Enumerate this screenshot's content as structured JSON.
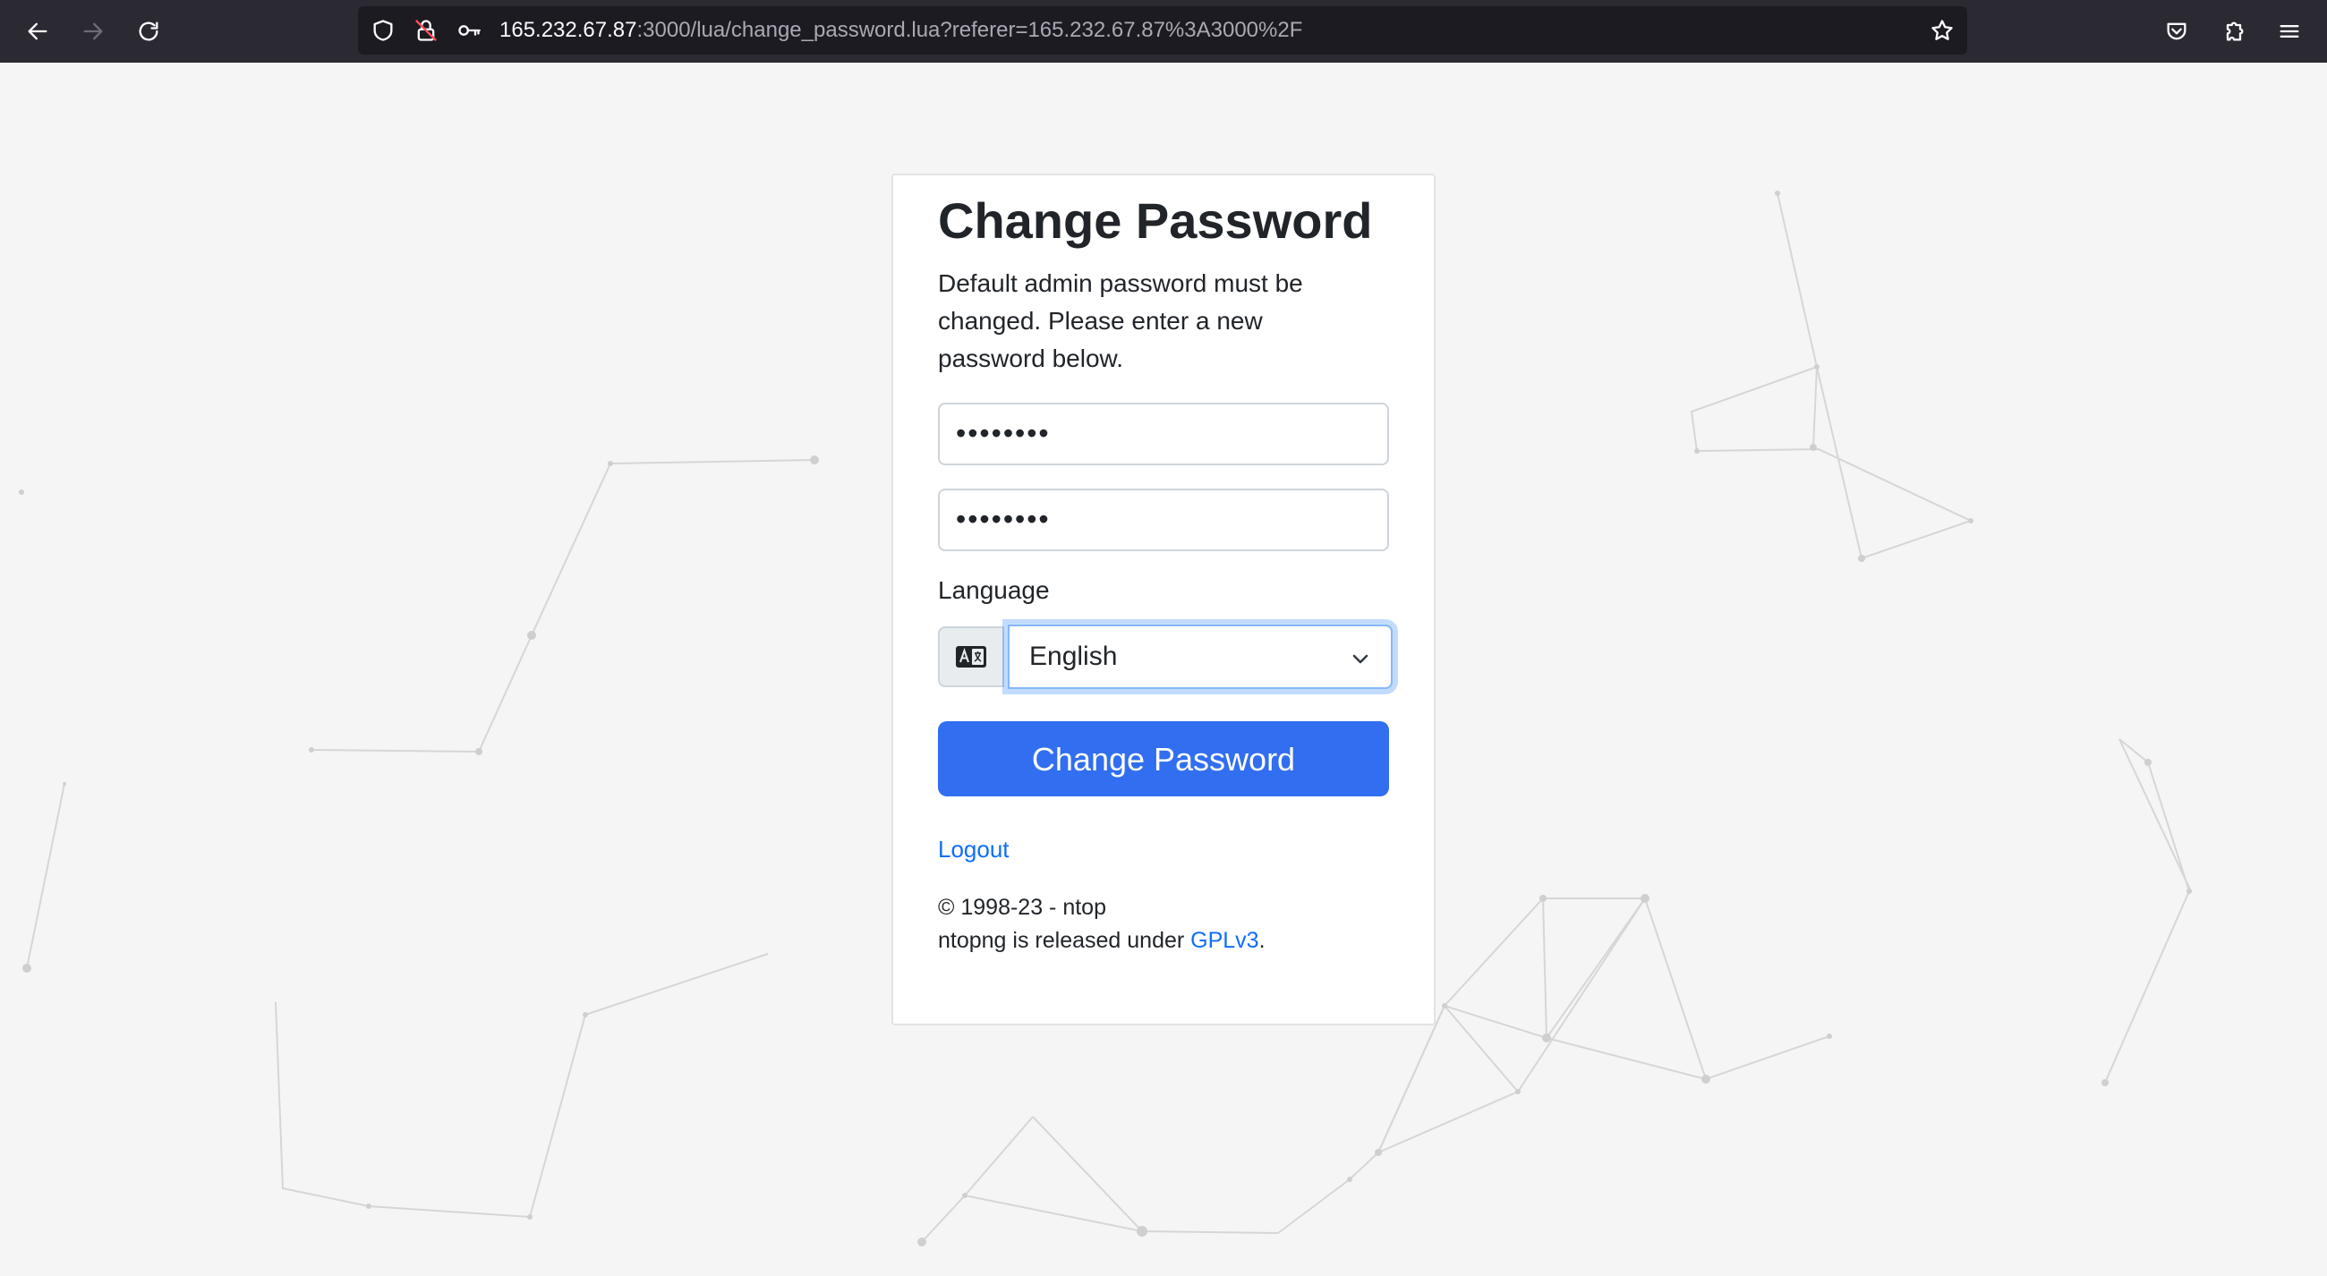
{
  "browser": {
    "url_host": "165.232.67.87",
    "url_rest": ":3000/lua/change_password.lua?referer=165.232.67.87%3A3000%2F"
  },
  "icons": {
    "back": "arrow-left-icon",
    "forward": "arrow-right-icon",
    "reload": "reload-icon",
    "shield": "shield-icon",
    "insecure": "insecure-lock-icon",
    "key": "key-icon",
    "bookmark": "star-icon",
    "pocket": "pocket-icon",
    "extensions": "puzzle-icon",
    "menu": "hamburger-menu-icon",
    "language": "translate-icon",
    "dropdown": "chevron-down-icon"
  },
  "form": {
    "title": "Change Password",
    "description": "Default admin password must be changed. Please enter a new password below.",
    "password_value": "••••••••",
    "confirm_value": "••••••••",
    "language_label": "Language",
    "language_selected": "English",
    "submit_label": "Change Password",
    "logout_label": "Logout"
  },
  "footer": {
    "copyright": "© 1998-23 - ntop",
    "license_prefix": "ntopng is released under ",
    "license_link": "GPLv3",
    "license_suffix": "."
  },
  "colors": {
    "primary": "#316ef0",
    "link": "#0d6efd",
    "toolbar": "#2b2a33",
    "urlbar": "#1c1b22",
    "page_background": "#f5f5f5"
  }
}
